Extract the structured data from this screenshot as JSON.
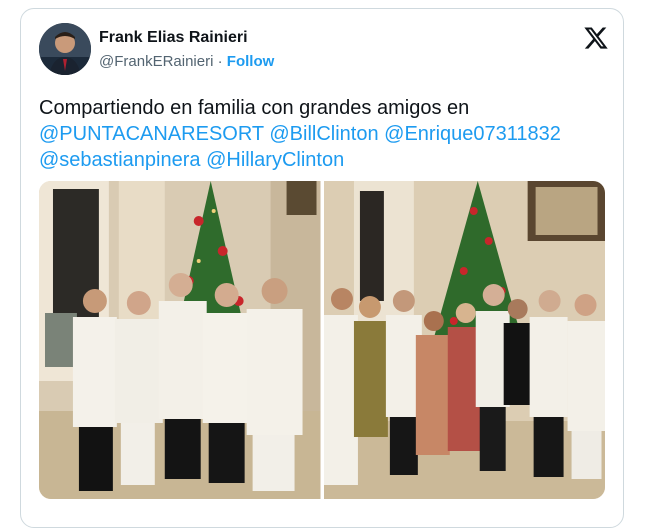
{
  "author": {
    "name": "Frank Elias Rainieri",
    "handle": "@FrankERainieri",
    "separator": "·",
    "follow_label": "Follow"
  },
  "tweet": {
    "text": "Compartiendo en familia con grandes amigos en",
    "mentions": [
      "@PUNTACANARESORT",
      "@BillClinton",
      "@Enrique07311832",
      "@sebastianpinera",
      "@HillaryClinton"
    ]
  },
  "icons": {
    "platform": "x-logo-icon"
  },
  "colors": {
    "link": "#1d9bf0",
    "text": "#0f1419",
    "muted": "#536471",
    "border": "#cfd9de"
  }
}
